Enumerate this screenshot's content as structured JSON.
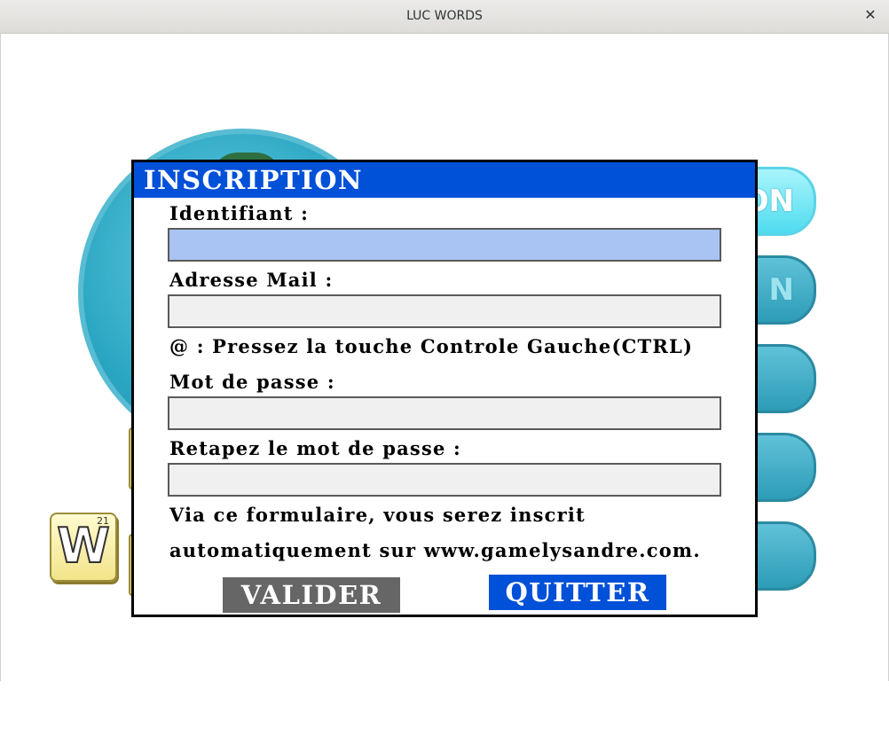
{
  "window": {
    "title": "LUC WORDS",
    "close_symbol": "✕"
  },
  "background": {
    "menu_buttons": [
      {
        "label": "ON"
      },
      {
        "label": "N"
      },
      {
        "label": ""
      },
      {
        "label": ""
      },
      {
        "label": ""
      }
    ],
    "tile": {
      "letter": "W",
      "points": "21"
    }
  },
  "dialog": {
    "title": "INSCRIPTION",
    "identifiant_label": "Identifiant :",
    "identifiant_value": "",
    "email_label": "Adresse Mail :",
    "email_value": "",
    "at_hint": "@ : Pressez la touche Controle Gauche(CTRL)",
    "password_label": "Mot de passe :",
    "password_value": "",
    "password_confirm_label": "Retapez le mot de passe :",
    "password_confirm_value": "",
    "info_line1": "Via ce formulaire, vous serez inscrit",
    "info_line2": "automatiquement sur www.gamelysandre.com.",
    "valider_label": "VALIDER",
    "quitter_label": "QUITTER"
  },
  "colors": {
    "header_blue": "#0050d8",
    "active_field": "#a9c3f2",
    "valider_gray": "#666666"
  }
}
